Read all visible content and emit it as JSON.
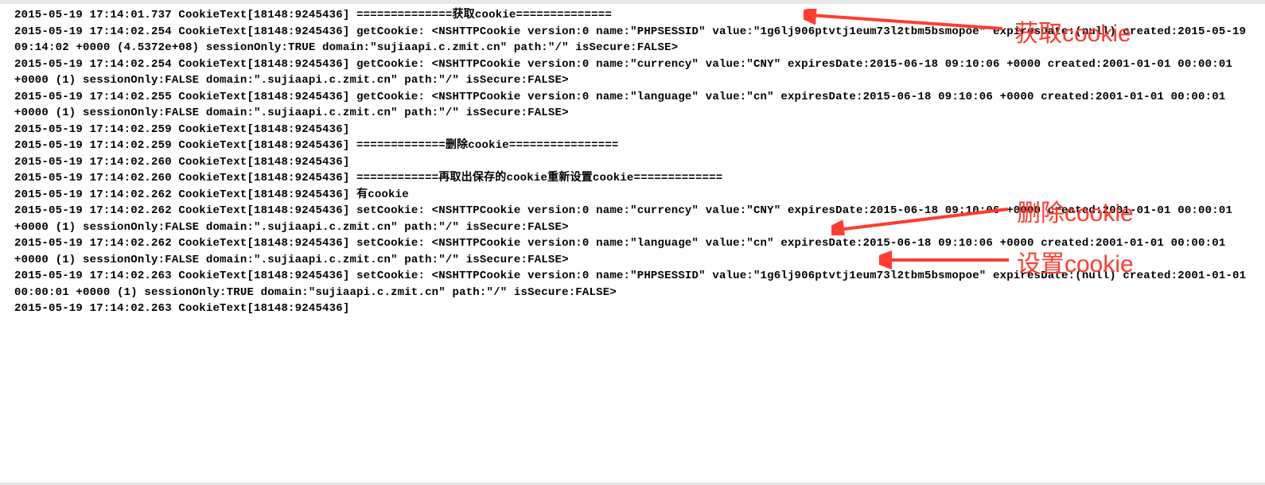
{
  "log_lines": [
    "2015-05-19 17:14:01.737 CookieText[18148:9245436] ==============获取cookie==============",
    "2015-05-19 17:14:02.254 CookieText[18148:9245436] getCookie: <NSHTTPCookie version:0 name:\"PHPSESSID\" value:\"1g6lj906ptvtj1eum73l2tbm5bsmopoe\" expiresDate:(null) created:2015-05-19 09:14:02 +0000 (4.5372e+08) sessionOnly:TRUE domain:\"sujiaapi.c.zmit.cn\" path:\"/\" isSecure:FALSE>",
    "2015-05-19 17:14:02.254 CookieText[18148:9245436] getCookie: <NSHTTPCookie version:0 name:\"currency\" value:\"CNY\" expiresDate:2015-06-18 09:10:06 +0000 created:2001-01-01 00:00:01 +0000 (1) sessionOnly:FALSE domain:\".sujiaapi.c.zmit.cn\" path:\"/\" isSecure:FALSE>",
    "2015-05-19 17:14:02.255 CookieText[18148:9245436] getCookie: <NSHTTPCookie version:0 name:\"language\" value:\"cn\" expiresDate:2015-06-18 09:10:06 +0000 created:2001-01-01 00:00:01 +0000 (1) sessionOnly:FALSE domain:\".sujiaapi.c.zmit.cn\" path:\"/\" isSecure:FALSE>",
    "2015-05-19 17:14:02.259 CookieText[18148:9245436] ",
    "2015-05-19 17:14:02.259 CookieText[18148:9245436] =============删除cookie================",
    "2015-05-19 17:14:02.260 CookieText[18148:9245436] ",
    "2015-05-19 17:14:02.260 CookieText[18148:9245436] ============再取出保存的cookie重新设置cookie=============",
    "2015-05-19 17:14:02.262 CookieText[18148:9245436] 有cookie",
    "2015-05-19 17:14:02.262 CookieText[18148:9245436] setCookie: <NSHTTPCookie version:0 name:\"currency\" value:\"CNY\" expiresDate:2015-06-18 09:10:06 +0000 created:2001-01-01 00:00:01 +0000 (1) sessionOnly:FALSE domain:\".sujiaapi.c.zmit.cn\" path:\"/\" isSecure:FALSE>",
    "2015-05-19 17:14:02.262 CookieText[18148:9245436] setCookie: <NSHTTPCookie version:0 name:\"language\" value:\"cn\" expiresDate:2015-06-18 09:10:06 +0000 created:2001-01-01 00:00:01 +0000 (1) sessionOnly:FALSE domain:\".sujiaapi.c.zmit.cn\" path:\"/\" isSecure:FALSE>",
    "2015-05-19 17:14:02.263 CookieText[18148:9245436] setCookie: <NSHTTPCookie version:0 name:\"PHPSESSID\" value:\"1g6lj906ptvtj1eum73l2tbm5bsmopoe\" expiresDate:(null) created:2001-01-01 00:00:01 +0000 (1) sessionOnly:TRUE domain:\"sujiaapi.c.zmit.cn\" path:\"/\" isSecure:FALSE>",
    "2015-05-19 17:14:02.263 CookieText[18148:9245436] "
  ],
  "annotations": {
    "a1": "获取cookie",
    "a2": "删除cookie",
    "a3": "设置cookie"
  }
}
